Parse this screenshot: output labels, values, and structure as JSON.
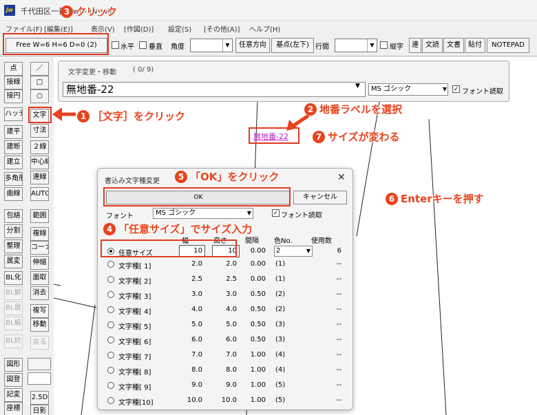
{
  "window": {
    "title": "千代田区一番  .jwf - jw_win",
    "logo": "jw"
  },
  "menu": [
    "ファイル(F)",
    "[編集(E)]",
    "表示(V)",
    "[作図(D)]",
    "設定(S)",
    "[その他(A)]",
    "ヘルプ(H)"
  ],
  "toolbar": {
    "free_status": "Free  W=6 H=6 D=0 (2)",
    "horizontal": "水平",
    "vertical": "垂直",
    "angle": "角度",
    "arbitrary_dir": "任意方向",
    "base_point": "基点(左下)",
    "line_spacing": "行間",
    "vertical_text": "縦字",
    "ren": "連",
    "bunsen": "文読",
    "bunsho": "文書",
    "haritsuke": "貼付",
    "notepad": "NOTEPAD"
  },
  "palette": {
    "left": [
      "点",
      "接線",
      "接円",
      "ハッチ",
      "建平",
      "建断",
      "建立",
      "多角形",
      "曲線",
      "包絡",
      "分割",
      "整理",
      "属変",
      "BL化",
      "BL解",
      "BL属",
      "BL編",
      "BL終",
      "図形",
      "図登",
      "記変",
      "座標"
    ],
    "right": [
      "／",
      "□",
      "○",
      "文字",
      "寸法",
      "２線",
      "中心線",
      "連線",
      "AUTO",
      "範囲",
      "複線",
      "コーナー",
      "伸縮",
      "面取",
      "消去",
      "複写",
      "移動",
      "戻る",
      "",
      "",
      "2.5D",
      "日影"
    ]
  },
  "text_dialog": {
    "title": "文字変更・移動",
    "count": "( 0/  9)",
    "text_value": "無地番-22",
    "font": "MS ゴシック",
    "font_read": "フォント読取"
  },
  "canvas": {
    "selected_label": "無地番-22"
  },
  "font_dialog": {
    "title": "書込み文字種変更",
    "ok": "OK",
    "cancel": "キャンセル",
    "font_label": "フォント",
    "font_value": "MS ゴシック",
    "font_read": "フォント読取",
    "headers": {
      "width": "幅",
      "height": "高さ",
      "spacing": "間隔",
      "color": "色No.",
      "used": "使用数"
    },
    "custom": {
      "name": "任意サイズ",
      "width": "10",
      "height": "10",
      "spacing": "0.00",
      "color": "2",
      "used": "6"
    },
    "rows": [
      {
        "name": "文字種[ 1]",
        "width": "2.0",
        "height": "2.0",
        "spacing": "0.00",
        "color": "(1)",
        "used": "--"
      },
      {
        "name": "文字種[ 2]",
        "width": "2.5",
        "height": "2.5",
        "spacing": "0.00",
        "color": "(1)",
        "used": "--"
      },
      {
        "name": "文字種[ 3]",
        "width": "3.0",
        "height": "3.0",
        "spacing": "0.50",
        "color": "(2)",
        "used": "--"
      },
      {
        "name": "文字種[ 4]",
        "width": "4.0",
        "height": "4.0",
        "spacing": "0.50",
        "color": "(2)",
        "used": "--"
      },
      {
        "name": "文字種[ 5]",
        "width": "5.0",
        "height": "5.0",
        "spacing": "0.50",
        "color": "(3)",
        "used": "--"
      },
      {
        "name": "文字種[ 6]",
        "width": "6.0",
        "height": "6.0",
        "spacing": "0.50",
        "color": "(3)",
        "used": "--"
      },
      {
        "name": "文字種[ 7]",
        "width": "7.0",
        "height": "7.0",
        "spacing": "1.00",
        "color": "(4)",
        "used": "--"
      },
      {
        "name": "文字種[ 8]",
        "width": "8.0",
        "height": "8.0",
        "spacing": "1.00",
        "color": "(4)",
        "used": "--"
      },
      {
        "name": "文字種[ 9]",
        "width": "9.0",
        "height": "9.0",
        "spacing": "1.00",
        "color": "(5)",
        "used": "--"
      },
      {
        "name": "文字種[10]",
        "width": "10.0",
        "height": "10.0",
        "spacing": "1.00",
        "color": "(5)",
        "used": "--"
      }
    ]
  },
  "annotations": {
    "a1": {
      "num": "1",
      "text": "［文字］をクリック"
    },
    "a2": {
      "num": "2",
      "text": "地番ラベルを選択"
    },
    "a3": {
      "num": "3",
      "text": "クリック"
    },
    "a4": {
      "num": "4",
      "text": "「任意サイズ」でサイズ入力"
    },
    "a5": {
      "num": "5",
      "text": "「OK」をクリック"
    },
    "a6": {
      "num": "6",
      "text": "Enterキーを押す"
    },
    "a7": {
      "num": "7",
      "text": "サイズが変わる"
    }
  },
  "colors": {
    "annotation": "#e8421c",
    "label": "#c020c0"
  }
}
